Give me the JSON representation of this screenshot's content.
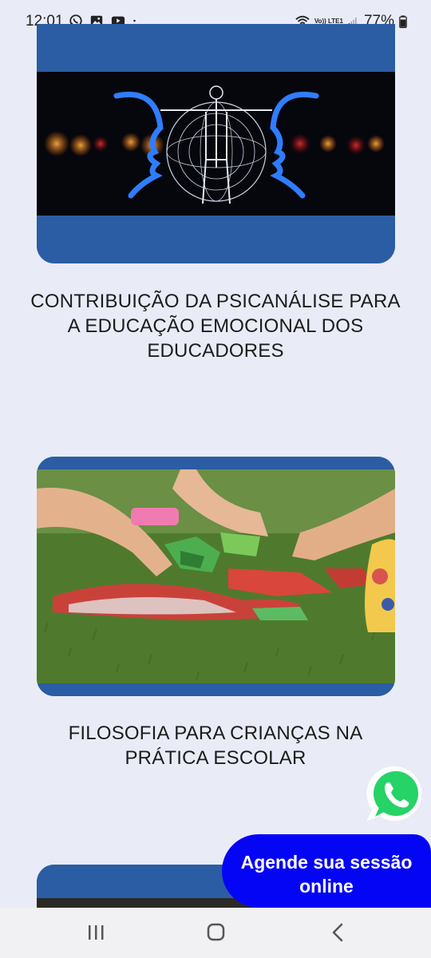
{
  "status_bar": {
    "time": "12:01",
    "battery": "77%",
    "network_label": "Vo)) LTE1",
    "icons": [
      "whatsapp-icon",
      "gallery-icon",
      "youtube-icon",
      "dot-icon",
      "wifi-icon",
      "signal-icon",
      "battery-icon"
    ]
  },
  "cards": [
    {
      "title": "CONTRIBUIÇÃO DA PSICANÁLISE PARA A EDUCAÇÃO EMOCIONAL DOS EDUCADORES"
    },
    {
      "title": "FILOSOFIA PARA CRIANÇAS NA PRÁTICA ESCOLAR"
    }
  ],
  "cta": {
    "label": "Agende sua sessão online"
  },
  "nav": {
    "icons": [
      "recent-apps-icon",
      "home-icon",
      "back-icon"
    ]
  },
  "colors": {
    "accent_blue": "#2a5da3",
    "cta_blue": "#0505f5",
    "whatsapp_green": "#25d366",
    "background": "#e9ecf6"
  }
}
